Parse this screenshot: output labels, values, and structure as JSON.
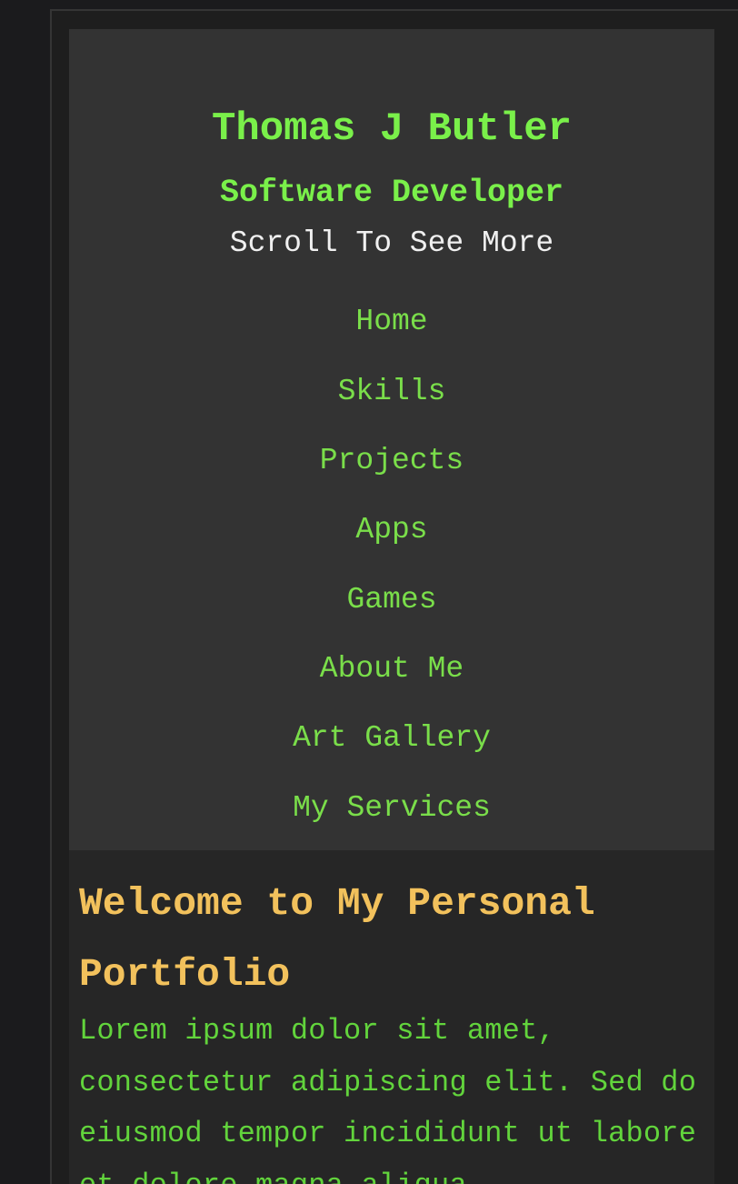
{
  "header": {
    "name": "Thomas J Butler",
    "role": "Software Developer",
    "scroll_hint": "Scroll To See More"
  },
  "nav": {
    "items": [
      {
        "label": "Home"
      },
      {
        "label": "Skills"
      },
      {
        "label": "Projects"
      },
      {
        "label": "Apps"
      },
      {
        "label": "Games"
      },
      {
        "label": "About Me"
      },
      {
        "label": "Art Gallery"
      },
      {
        "label": "My Services"
      }
    ]
  },
  "main": {
    "title": "Welcome to My Personal Portfolio",
    "intro": "Lorem ipsum dolor sit amet, consectetur adipiscing elit. Sed do eiusmod tempor incididunt ut labore et dolore magna aliqua."
  },
  "colors": {
    "page_background": "#1b1b1d",
    "header_background": "#333333",
    "content_background": "#262626",
    "accent_green": "#7af04a",
    "title_gold": "#f2c15c",
    "text_white": "#f0f0f0"
  }
}
